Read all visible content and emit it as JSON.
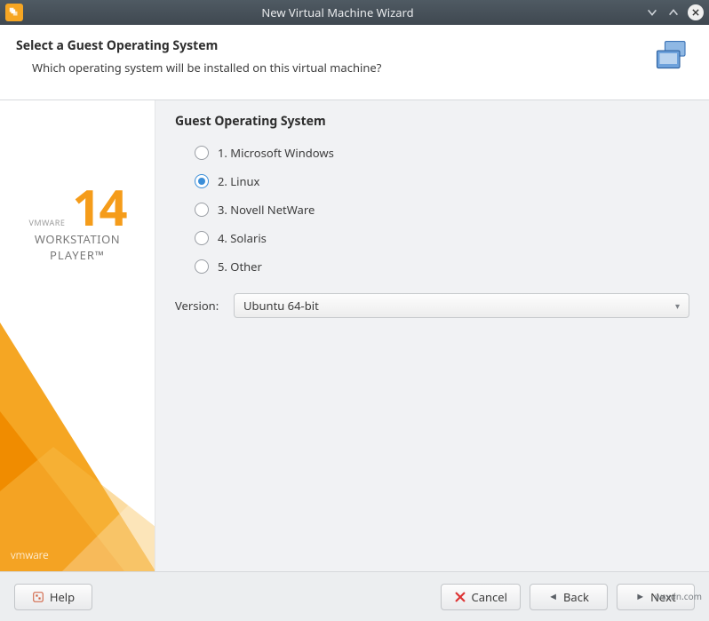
{
  "window": {
    "title": "New Virtual Machine Wizard"
  },
  "header": {
    "heading": "Select a Guest Operating System",
    "subtext": "Which operating system will be installed on this virtual machine?"
  },
  "branding": {
    "number": "14",
    "vmware_small": "VMWARE",
    "title": "WORKSTATION",
    "subtitle": "PLAYER™",
    "footer_logo": "vmware"
  },
  "main": {
    "group_title": "Guest Operating System",
    "options": [
      {
        "label": "1. Microsoft Windows",
        "selected": false
      },
      {
        "label": "2. Linux",
        "selected": true
      },
      {
        "label": "3. Novell NetWare",
        "selected": false
      },
      {
        "label": "4. Solaris",
        "selected": false
      },
      {
        "label": "5. Other",
        "selected": false
      }
    ],
    "version_label": "Version:",
    "version_value": "Ubuntu 64-bit"
  },
  "footer": {
    "help": "Help",
    "cancel": "Cancel",
    "back": "Back",
    "next": "Next"
  },
  "watermark": "wsxdn.com"
}
